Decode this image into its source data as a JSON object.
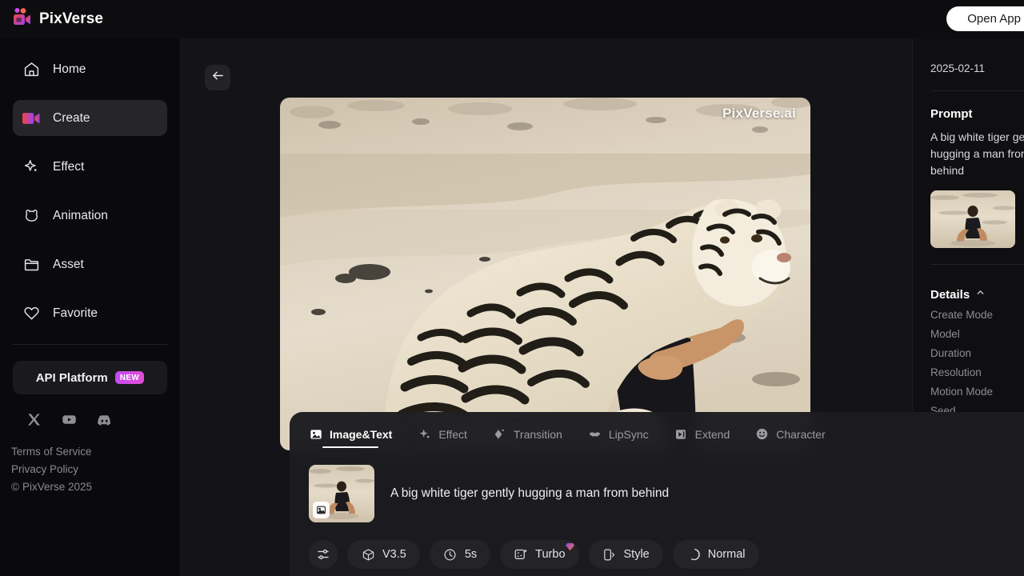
{
  "header": {
    "brand_name": "PixVerse",
    "logo_icon": "video-camera-icon",
    "open_app_label": "Open App"
  },
  "sidebar": {
    "items": [
      {
        "label": "Home",
        "icon": "home-icon",
        "active": false
      },
      {
        "label": "Create",
        "icon": "video-camera-icon",
        "active": true
      },
      {
        "label": "Effect",
        "icon": "sparkle-icon",
        "active": false
      },
      {
        "label": "Animation",
        "icon": "animation-face-icon",
        "active": false
      },
      {
        "label": "Asset",
        "icon": "folder-icon",
        "active": false
      },
      {
        "label": "Favorite",
        "icon": "heart-icon",
        "active": false
      }
    ],
    "api_platform": {
      "label": "API Platform",
      "badge": "NEW"
    },
    "socials": [
      {
        "name": "x-icon"
      },
      {
        "name": "youtube-icon"
      },
      {
        "name": "discord-icon"
      }
    ],
    "footer": {
      "terms": "Terms of Service",
      "privacy": "Privacy Policy",
      "copyright": "PixVerse 2025",
      "copyright_symbol": "©"
    }
  },
  "stage": {
    "back_icon": "arrow-left-icon",
    "video": {
      "watermark": "PixVerse.ai",
      "alt": "A white tiger hugging a seated man on a sandy beach"
    }
  },
  "bottom_panel": {
    "tabs": [
      {
        "label": "Image&Text",
        "icon": "image-icon",
        "active": true
      },
      {
        "label": "Effect",
        "icon": "sparkle-icon",
        "active": false
      },
      {
        "label": "Transition",
        "icon": "transition-icon",
        "active": false
      },
      {
        "label": "LipSync",
        "icon": "lips-icon",
        "active": false
      },
      {
        "label": "Extend",
        "icon": "extend-icon",
        "active": false
      },
      {
        "label": "Character",
        "icon": "smiley-icon",
        "active": false
      }
    ],
    "prompt": {
      "text": "A big white tiger gently hugging a man from behind",
      "thumbnail_badge_icon": "image-icon"
    },
    "chips": [
      {
        "label": "",
        "icon": "sliders-icon",
        "icon_only": true
      },
      {
        "label": "V3.5",
        "icon": "cube-icon",
        "icon_only": false
      },
      {
        "label": "5s",
        "icon": "clock-icon",
        "icon_only": false
      },
      {
        "label": "Turbo",
        "icon": "turbo-icon",
        "icon_only": false,
        "gem": true
      },
      {
        "label": "Style",
        "icon": "style-frame-icon",
        "icon_only": false
      },
      {
        "label": "Normal",
        "icon": "motion-icon",
        "icon_only": false
      }
    ]
  },
  "right_panel": {
    "date": "2025-02-11",
    "prompt_title": "Prompt",
    "prompt_text": "A big white tiger gently hugging a man from behind",
    "details_title": "Details",
    "details_chevron": "chevron-up-icon",
    "details_keys": [
      "Create Mode",
      "Model",
      "Duration",
      "Resolution",
      "Motion Mode",
      "Seed"
    ]
  },
  "colors": {
    "accent_gradient_start": "#f1453d",
    "accent_gradient_end": "#9b44f7",
    "badge_gradient_start": "#c24bf5",
    "badge_gradient_end": "#e24fd2",
    "panel_bg": "#1c1c20",
    "app_bg": "#0a0a0c"
  }
}
